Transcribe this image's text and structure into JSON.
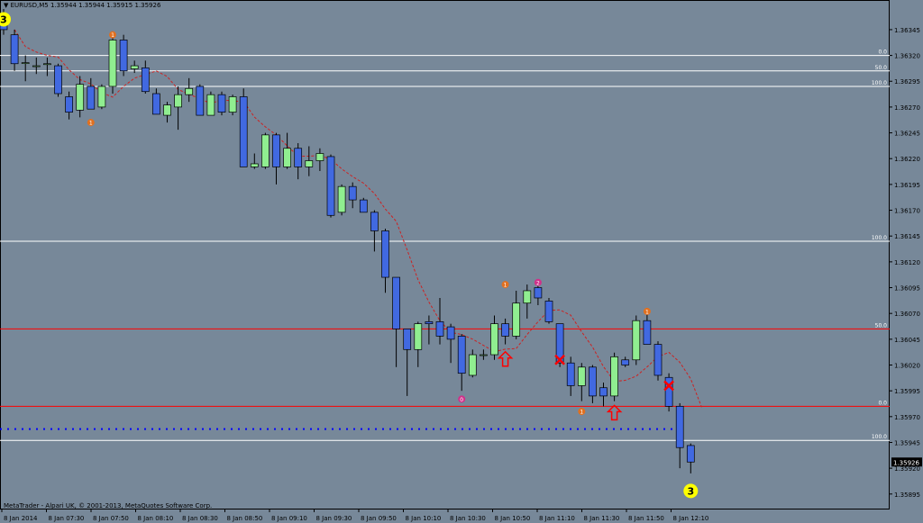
{
  "window": {
    "title_prefix": "▼",
    "symbol": "EURUSD,M5",
    "ohlc": "1.35944 1.35944 1.35915 1.35926",
    "copyright": "MetaTrader - Alpari UK, © 2001-2013, MetaQuotes Software Corp."
  },
  "colors": {
    "background": "#778899",
    "bull_candle": "#90ee90",
    "bear_candle": "#4169e1",
    "wick": "#000000",
    "fib_white": "#ffffff",
    "fib_red": "#ff0000",
    "dotted_level": "#0000ff",
    "ma": "#cc2222",
    "markers": "#ff0000"
  },
  "chart_data": {
    "type": "candlestick",
    "y_ticks": [
      "1.36345",
      "1.36320",
      "1.36295",
      "1.36270",
      "1.36245",
      "1.36220",
      "1.36195",
      "1.36170",
      "1.36145",
      "1.36120",
      "1.36095",
      "1.36070",
      "1.36045",
      "1.36020",
      "1.35995",
      "1.35970",
      "1.35945",
      "1.35920",
      "1.35895"
    ],
    "ylim": [
      1.3588,
      1.36365
    ],
    "x_ticks": [
      "8 Jan 2014",
      "8 Jan 07:30",
      "8 Jan 07:50",
      "8 Jan 08:10",
      "8 Jan 08:30",
      "8 Jan 08:50",
      "8 Jan 09:10",
      "8 Jan 09:30",
      "8 Jan 09:50",
      "8 Jan 10:10",
      "8 Jan 10:30",
      "8 Jan 10:50",
      "8 Jan 11:10",
      "8 Jan 11:30",
      "8 Jan 11:50",
      "8 Jan 12:10"
    ],
    "current_price": "1.35926",
    "candles": [
      {
        "o": 1.3635,
        "h": 1.36365,
        "l": 1.3634,
        "c": 1.36345
      },
      {
        "o": 1.3634,
        "h": 1.36345,
        "l": 1.36305,
        "c": 1.36312
      },
      {
        "o": 1.36313,
        "h": 1.3632,
        "l": 1.36295,
        "c": 1.36313
      },
      {
        "o": 1.3631,
        "h": 1.36318,
        "l": 1.36302,
        "c": 1.3631
      },
      {
        "o": 1.36312,
        "h": 1.36318,
        "l": 1.363,
        "c": 1.36312
      },
      {
        "o": 1.3631,
        "h": 1.36312,
        "l": 1.3628,
        "c": 1.36283
      },
      {
        "o": 1.3628,
        "h": 1.36285,
        "l": 1.36258,
        "c": 1.36265
      },
      {
        "o": 1.36267,
        "h": 1.363,
        "l": 1.3626,
        "c": 1.36292
      },
      {
        "o": 1.3629,
        "h": 1.36298,
        "l": 1.36268,
        "c": 1.36268
      },
      {
        "o": 1.3627,
        "h": 1.36292,
        "l": 1.36268,
        "c": 1.3629
      },
      {
        "o": 1.3629,
        "h": 1.3634,
        "l": 1.36283,
        "c": 1.36335
      },
      {
        "o": 1.36335,
        "h": 1.3634,
        "l": 1.363,
        "c": 1.36305
      },
      {
        "o": 1.36307,
        "h": 1.36315,
        "l": 1.36303,
        "c": 1.3631
      },
      {
        "o": 1.36308,
        "h": 1.36315,
        "l": 1.36283,
        "c": 1.36285
      },
      {
        "o": 1.36283,
        "h": 1.36288,
        "l": 1.36263,
        "c": 1.36263
      },
      {
        "o": 1.36262,
        "h": 1.36275,
        "l": 1.36255,
        "c": 1.36272
      },
      {
        "o": 1.3627,
        "h": 1.3629,
        "l": 1.36248,
        "c": 1.36282
      },
      {
        "o": 1.36282,
        "h": 1.36298,
        "l": 1.36275,
        "c": 1.36288
      },
      {
        "o": 1.3629,
        "h": 1.36292,
        "l": 1.36262,
        "c": 1.36262
      },
      {
        "o": 1.36262,
        "h": 1.36285,
        "l": 1.36262,
        "c": 1.36282
      },
      {
        "o": 1.36282,
        "h": 1.36285,
        "l": 1.36262,
        "c": 1.36265
      },
      {
        "o": 1.36265,
        "h": 1.36282,
        "l": 1.36262,
        "c": 1.3628
      },
      {
        "o": 1.3628,
        "h": 1.36288,
        "l": 1.36212,
        "c": 1.36212
      },
      {
        "o": 1.36212,
        "h": 1.36225,
        "l": 1.3621,
        "c": 1.36215
      },
      {
        "o": 1.36212,
        "h": 1.36245,
        "l": 1.3621,
        "c": 1.36243
      },
      {
        "o": 1.36243,
        "h": 1.36245,
        "l": 1.36195,
        "c": 1.36212
      },
      {
        "o": 1.36212,
        "h": 1.36245,
        "l": 1.3621,
        "c": 1.3623
      },
      {
        "o": 1.3623,
        "h": 1.36235,
        "l": 1.362,
        "c": 1.36212
      },
      {
        "o": 1.36212,
        "h": 1.36232,
        "l": 1.36203,
        "c": 1.36218
      },
      {
        "o": 1.36218,
        "h": 1.3623,
        "l": 1.36208,
        "c": 1.36225
      },
      {
        "o": 1.36222,
        "h": 1.36224,
        "l": 1.36163,
        "c": 1.36165
      },
      {
        "o": 1.36168,
        "h": 1.36195,
        "l": 1.36165,
        "c": 1.36193
      },
      {
        "o": 1.36193,
        "h": 1.36197,
        "l": 1.36172,
        "c": 1.3618
      },
      {
        "o": 1.3618,
        "h": 1.36182,
        "l": 1.36168,
        "c": 1.36168
      },
      {
        "o": 1.36168,
        "h": 1.3617,
        "l": 1.3613,
        "c": 1.3615
      },
      {
        "o": 1.3615,
        "h": 1.36152,
        "l": 1.3609,
        "c": 1.36105
      },
      {
        "o": 1.36105,
        "h": 1.36105,
        "l": 1.36018,
        "c": 1.36055
      },
      {
        "o": 1.36055,
        "h": 1.36055,
        "l": 1.3599,
        "c": 1.36035
      },
      {
        "o": 1.36035,
        "h": 1.36062,
        "l": 1.36018,
        "c": 1.3606
      },
      {
        "o": 1.36062,
        "h": 1.36068,
        "l": 1.3604,
        "c": 1.3606
      },
      {
        "o": 1.36062,
        "h": 1.36085,
        "l": 1.3604,
        "c": 1.36048
      },
      {
        "o": 1.36057,
        "h": 1.3606,
        "l": 1.36022,
        "c": 1.36045
      },
      {
        "o": 1.36048,
        "h": 1.3605,
        "l": 1.35995,
        "c": 1.36012
      },
      {
        "o": 1.3601,
        "h": 1.36035,
        "l": 1.36008,
        "c": 1.3603
      },
      {
        "o": 1.3603,
        "h": 1.36035,
        "l": 1.36025,
        "c": 1.3603
      },
      {
        "o": 1.3603,
        "h": 1.36068,
        "l": 1.36025,
        "c": 1.3606
      },
      {
        "o": 1.3606,
        "h": 1.36065,
        "l": 1.3604,
        "c": 1.36048
      },
      {
        "o": 1.36048,
        "h": 1.36092,
        "l": 1.36045,
        "c": 1.3608
      },
      {
        "o": 1.3608,
        "h": 1.36098,
        "l": 1.36065,
        "c": 1.36092
      },
      {
        "o": 1.36095,
        "h": 1.36102,
        "l": 1.36078,
        "c": 1.36085
      },
      {
        "o": 1.36082,
        "h": 1.36085,
        "l": 1.3606,
        "c": 1.36062
      },
      {
        "o": 1.3606,
        "h": 1.3606,
        "l": 1.36018,
        "c": 1.36022
      },
      {
        "o": 1.36022,
        "h": 1.36028,
        "l": 1.3599,
        "c": 1.36
      },
      {
        "o": 1.36,
        "h": 1.36022,
        "l": 1.35985,
        "c": 1.36018
      },
      {
        "o": 1.36018,
        "h": 1.3602,
        "l": 1.35983,
        "c": 1.3599
      },
      {
        "o": 1.35998,
        "h": 1.36003,
        "l": 1.3598,
        "c": 1.3599
      },
      {
        "o": 1.3599,
        "h": 1.36032,
        "l": 1.35985,
        "c": 1.36028
      },
      {
        "o": 1.36025,
        "h": 1.36028,
        "l": 1.36018,
        "c": 1.3602
      },
      {
        "o": 1.36025,
        "h": 1.36068,
        "l": 1.3602,
        "c": 1.36063
      },
      {
        "o": 1.36063,
        "h": 1.3607,
        "l": 1.3604,
        "c": 1.3604
      },
      {
        "o": 1.3604,
        "h": 1.36043,
        "l": 1.36005,
        "c": 1.3601
      },
      {
        "o": 1.36008,
        "h": 1.36012,
        "l": 1.35975,
        "c": 1.3598
      },
      {
        "o": 1.3598,
        "h": 1.35983,
        "l": 1.3592,
        "c": 1.3594
      },
      {
        "o": 1.35942,
        "h": 1.35944,
        "l": 1.35915,
        "c": 1.35926
      }
    ],
    "horizontal_levels": [
      {
        "price": 1.3632,
        "label": "0.0",
        "color": "white"
      },
      {
        "price": 1.36305,
        "label": "50.0",
        "color": "white"
      },
      {
        "price": 1.3629,
        "label": "100.0",
        "color": "white"
      },
      {
        "price": 1.3614,
        "label": "100.0",
        "color": "white"
      },
      {
        "price": 1.36055,
        "label": "50.0",
        "color": "red"
      },
      {
        "price": 1.3598,
        "label": "0.0",
        "color": "red"
      },
      {
        "price": 1.35947,
        "label": "100.0",
        "color": "white"
      }
    ],
    "dotted_level": 1.35958,
    "wave_labels": [
      {
        "text": "3",
        "candle": 0,
        "price": 1.36355,
        "style": "yellow"
      },
      {
        "text": "3",
        "candle": 63,
        "price": 1.35898,
        "style": "yellow"
      },
      {
        "text": "1",
        "candle": 10,
        "price": 1.3634,
        "style": "orange"
      },
      {
        "text": "1",
        "candle": 8,
        "price": 1.36255,
        "style": "orange"
      },
      {
        "text": "1",
        "candle": 46,
        "price": 1.36098,
        "style": "orange"
      },
      {
        "text": "1",
        "candle": 53,
        "price": 1.35975,
        "style": "orange"
      },
      {
        "text": "1",
        "candle": 59,
        "price": 1.36072,
        "style": "orange"
      },
      {
        "text": "2",
        "candle": 49,
        "price": 1.361,
        "style": "magenta"
      },
      {
        "text": "0",
        "candle": 42,
        "price": 1.35987,
        "style": "magenta"
      }
    ],
    "arrows": [
      {
        "candle": 46,
        "price": 1.36025
      },
      {
        "candle": 56,
        "price": 1.35973
      }
    ],
    "crosses": [
      {
        "candle": 51,
        "price": 1.36025
      },
      {
        "candle": 61,
        "price": 1.36
      }
    ]
  }
}
